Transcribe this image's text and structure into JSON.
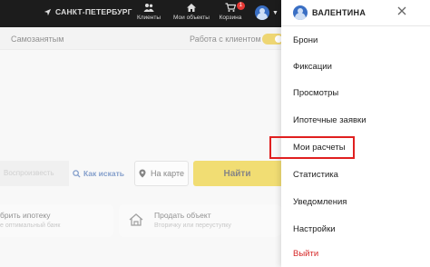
{
  "header": {
    "city": "САНКТ-ПЕТЕРБУРГ",
    "nav": [
      {
        "label": "Клиенты",
        "icon": "users-icon"
      },
      {
        "label": "Мои объекты",
        "icon": "home-icon"
      },
      {
        "label": "Корзина",
        "icon": "cart-icon",
        "badge": "1"
      }
    ]
  },
  "main": {
    "self_employed": "Самозанятым",
    "work_with_client": "Работа с клиентом",
    "search_placeholder": "Воспроизвесть",
    "how_to_search": "Как искать",
    "on_map": "На карте",
    "find": "Найти",
    "cards": [
      {
        "title": "брить ипотеку",
        "subtitle": "е оптимальный банк"
      },
      {
        "title": "Продать объект",
        "subtitle": "Вторичку или переуступку"
      }
    ]
  },
  "user_menu": {
    "name": "ВАЛЕНТИНА",
    "items": [
      "Брони",
      "Фиксации",
      "Просмотры",
      "Ипотечные заявки",
      "Мои расчеты",
      "Статистика",
      "Уведомления",
      "Настройки"
    ],
    "logout": "Выйти",
    "highlighted_item": "Мои расчеты"
  },
  "colors": {
    "header_bg": "#1c1c1c",
    "accent_yellow": "#e6c100",
    "link_blue": "#1e4fa0",
    "logout_red": "#d62828",
    "highlight_red": "#e02020"
  }
}
